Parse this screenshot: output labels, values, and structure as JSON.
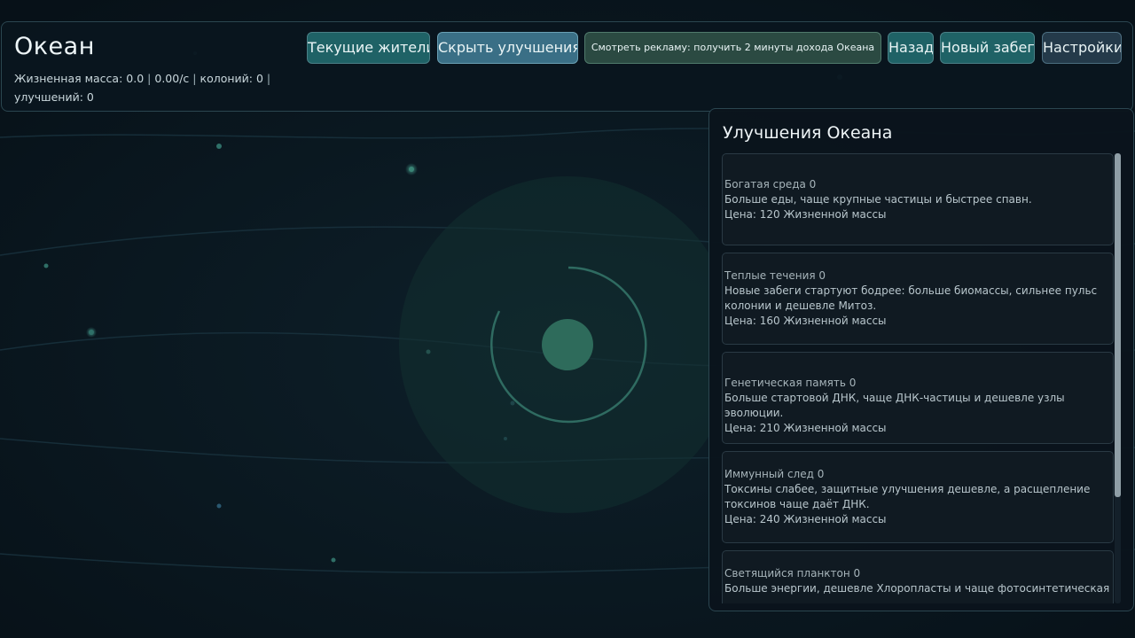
{
  "header": {
    "title": "Океан",
    "stats": {
      "biomass": "Жизненная масса: 0.0",
      "rate": "0.00/с",
      "colonies": "колоний: 0",
      "upgrades": "улучшений: 0"
    },
    "buttons": {
      "current_residents": "Текущие жители",
      "hide_upgrades": "Скрыть улучшения",
      "watch_ad": "Смотреть рекламу: получить 2 минуты дохода Океана",
      "back": "Назад",
      "new_run": "Новый забег",
      "settings": "Настройки"
    }
  },
  "upgrades_panel": {
    "title": "Улучшения Океана",
    "items": [
      {
        "name": "Богатая среда 0",
        "desc": "Больше еды, чаще крупные частицы и быстрее спавн.",
        "price": "Цена: 120 Жизненной массы"
      },
      {
        "name": "Теплые течения 0",
        "desc": "Новые забеги стартуют бодрее: больше биомассы, сильнее пульс колонии и дешевле Митоз.",
        "price": "Цена: 160 Жизненной массы"
      },
      {
        "name": "Генетическая память 0",
        "desc": "Больше стартовой ДНК, чаще ДНК-частицы и дешевле узлы эволюции.",
        "price": "Цена: 210 Жизненной массы"
      },
      {
        "name": "Иммунный след 0",
        "desc": "Токсины слабее, защитные улучшения дешевле, а расщепление токсинов чаще даёт ДНК.",
        "price": "Цена: 240 Жизненной массы"
      },
      {
        "name": "Светящийся планктон 0",
        "desc": "Больше энергии, дешевле Хлоропласты и чаще фотосинтетическая",
        "price": ""
      }
    ]
  },
  "colors": {
    "background": "#0a141c",
    "button_teal": "#1f6266",
    "button_blue": "#3a6f86",
    "panel_border": "#2b4650",
    "cell_core": "#2f6b5c"
  }
}
